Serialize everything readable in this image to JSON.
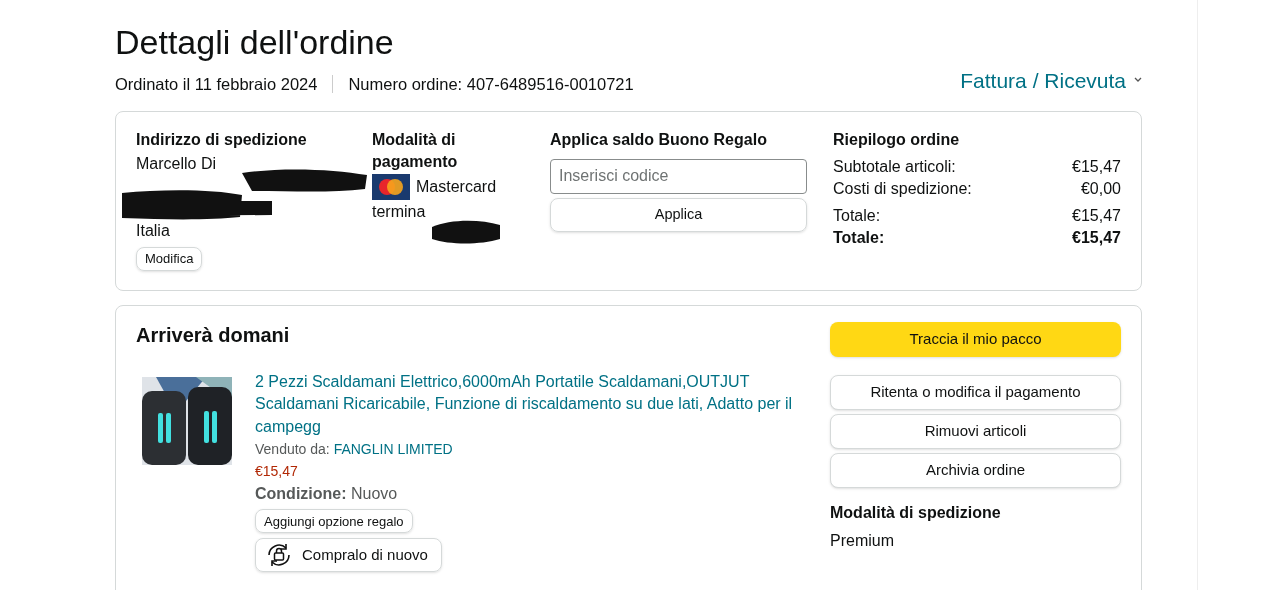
{
  "title": "Dettagli dell'ordine",
  "order_date": "Ordinato il 11 febbraio 2024",
  "order_number": "Numero ordine: 407-6489516-0010721",
  "invoice_link": "Fattura / Ricevuta",
  "shipping_address": {
    "heading": "Indirizzo di spedizione",
    "name": "Marcello Di",
    "country": "Italia",
    "edit_button": "Modifica"
  },
  "payment": {
    "heading": "Modalità di pagamento",
    "card": "Mastercard",
    "ending": "termina"
  },
  "gift_card": {
    "heading": "Applica saldo Buono Regalo",
    "placeholder": "Inserisci codice",
    "button": "Applica"
  },
  "summary": {
    "heading": "Riepilogo ordine",
    "rows": [
      {
        "label": "Subtotale articoli:",
        "value": "€15,47",
        "bold": false
      },
      {
        "label": "Costi di spedizione:",
        "value": "€0,00",
        "bold": false
      },
      {
        "label": "Totale:",
        "value": "€15,47",
        "bold": false
      },
      {
        "label": "Totale:",
        "value": "€15,47",
        "bold": true
      }
    ]
  },
  "shipment": {
    "heading": "Arriverà domani",
    "item": {
      "kind": "picture",
      "title": "2 Pezzi Scaldamani Elettrico,6000mAh Portatile Scaldamani,OUTJUT Scaldamani Ricaricabile, Funzione di riscaldamento su due lati, Adatto per il campegg",
      "sold_by_label": "Venduto da:",
      "seller": "FANGLIN LIMITED",
      "price": "€15,47",
      "condition_label": "Condizione:",
      "condition": "Nuovo",
      "gift_button": "Aggiungi opzione regalo",
      "buy_again_button": "Compralo di nuovo"
    },
    "actions": [
      {
        "label": "Traccia il mio pacco",
        "kind": "primary"
      },
      {
        "label": "Ritenta o modifica il pagamento",
        "kind": "secondary"
      },
      {
        "label": "Rimuovi articoli",
        "kind": "secondary"
      },
      {
        "label": "Archivia ordine",
        "kind": "secondary"
      }
    ],
    "shipping_method_heading": "Modalità di spedizione",
    "shipping_method": "Premium"
  }
}
